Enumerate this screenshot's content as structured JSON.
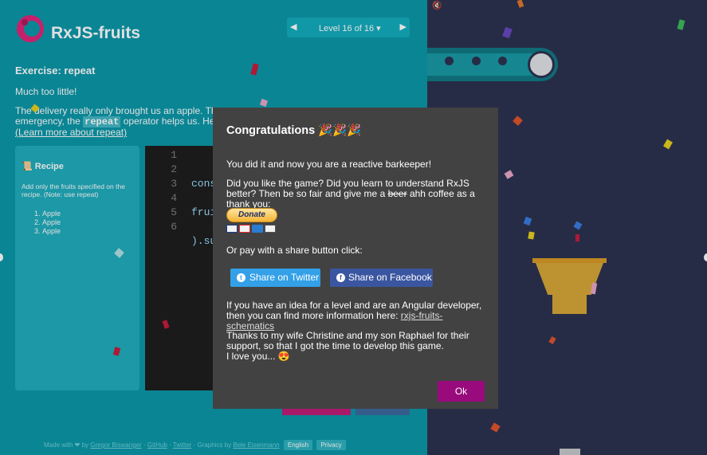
{
  "app": {
    "title": "RxJS-fruits"
  },
  "levels": {
    "prev": "◀",
    "next": "▶",
    "label": "Level 16 of 16 ▾"
  },
  "exercise": {
    "title": "Exercise: repeat",
    "p1": "Much too little!",
    "p2_start": "The delivery really only brought us an apple. The re",
    "p2_mid": "emergency, the ",
    "p2_code": "repeat",
    "p2_end": " operator helps us. He rep",
    "learn_more": "(Learn more about repeat)"
  },
  "recipe": {
    "heading": "Recipe",
    "desc": "Add only the fruits specified on the recipe. (Note: use repeat)",
    "items": [
      "Apple",
      "Apple",
      "Apple"
    ]
  },
  "editor": {
    "line_numbers": [
      "1",
      "2",
      "3",
      "4",
      "5",
      "6"
    ],
    "lines": [
      "cons",
      "",
      "frui",
      "",
      ").su",
      ""
    ]
  },
  "footer": {
    "made_with": "Made with ❤ by",
    "author": "Gregor Biswanger",
    "github": "GitHub",
    "twitter": "Twitter",
    "graphics_by": "Graphics by",
    "graphics_author": "Bele Eisenmann",
    "lang": "English",
    "privacy": "Privacy"
  },
  "stage": {
    "mute_icon": "🔇"
  },
  "modal": {
    "title": "Congratulations",
    "title_emoji": "🎉🎉🎉",
    "p1": "You did it and now you are a reactive barkeeper!",
    "p2_a": "Did you like the game? Did you learn to understand RxJS better? Then be so fair and give me a ",
    "p2_struck": "beer",
    "p2_b": " ahh coffee as a thank you:",
    "donate": "Donate",
    "p3": "Or pay with a share button click:",
    "share_twitter": "Share on Twitter",
    "share_facebook": "Share on Facebook",
    "p4": "If you have an idea for a level and are an Angular developer, then you can find more information here: ",
    "p4_link": "rxjs-fruits-schematics",
    "p5": "Thanks to my wife Christine and my son Raphael for their support, so that I got the time to develop this game.",
    "p5_b": "I love you... 😍",
    "ok": "Ok"
  },
  "colors": {
    "primary": "#0c98a9",
    "stage": "#2d3350",
    "modal": "#424242",
    "ok": "#990a7d",
    "twitter": "#33a0e8",
    "facebook": "#3b56a0"
  }
}
